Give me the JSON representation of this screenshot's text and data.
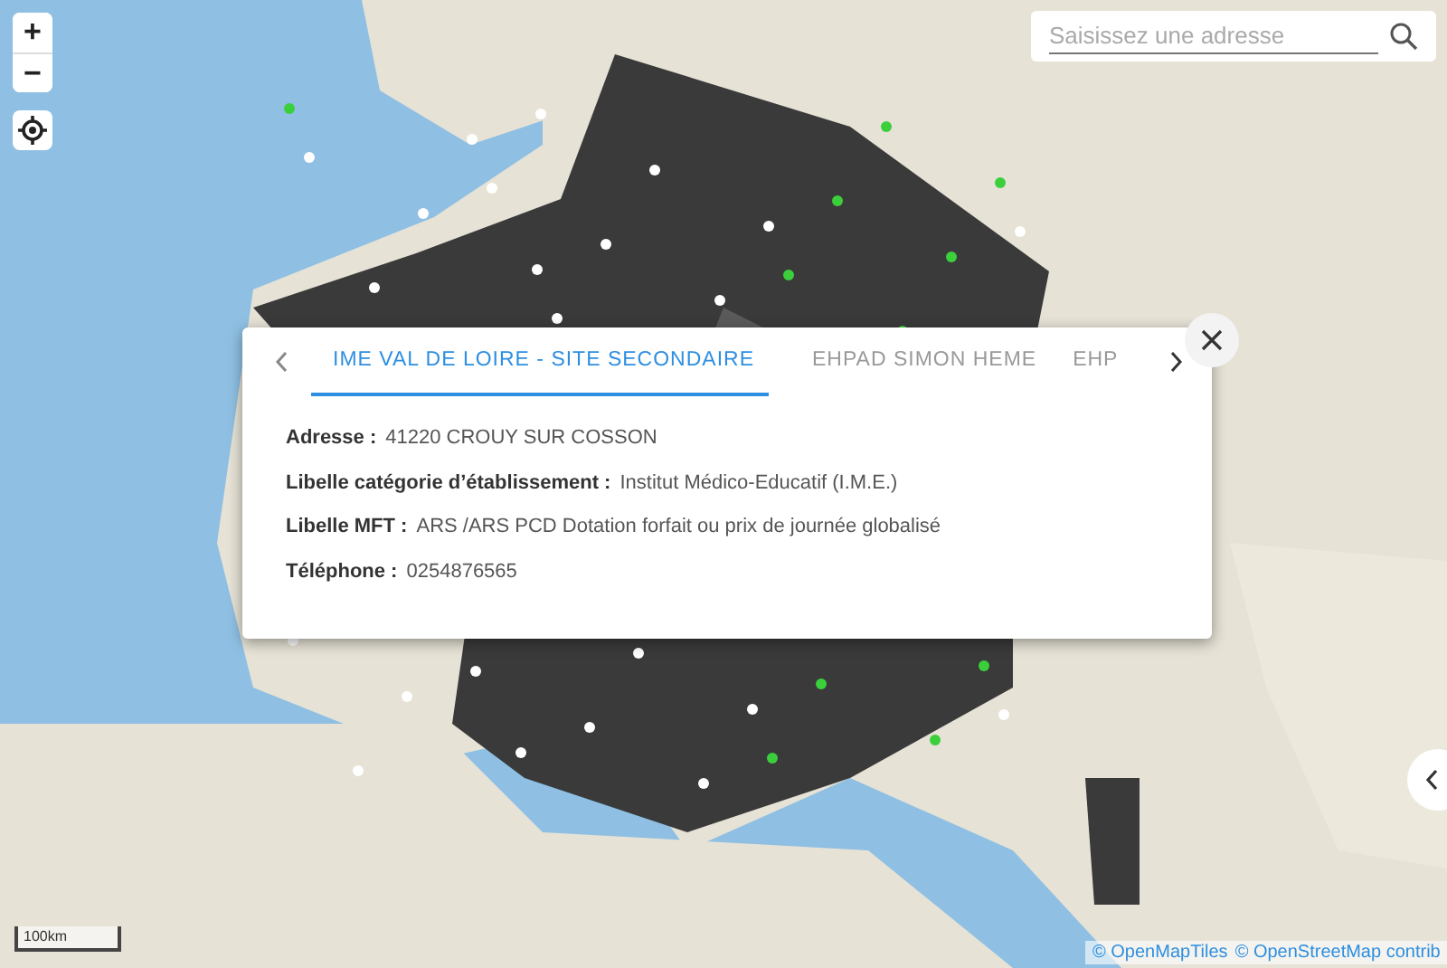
{
  "zoom_controls": {
    "zoom_in": "+",
    "zoom_out": "−"
  },
  "search": {
    "placeholder": "Saisissez une adresse"
  },
  "popup": {
    "tabs": [
      {
        "label": "IME VAL DE LOIRE - SITE SECONDAIRE",
        "selected": true
      },
      {
        "label": "EHPAD SIMON HEME",
        "selected": false
      },
      {
        "label": "EHP",
        "selected": false
      }
    ],
    "fields": [
      {
        "label": "Adresse :",
        "value": "41220 CROUY SUR COSSON"
      },
      {
        "label": "Libelle catégorie d’établissement :",
        "value": "Institut Médico-Educatif (I.M.E.)"
      },
      {
        "label": "Libelle MFT :",
        "value": "ARS /ARS PCD Dotation forfait ou prix de journée globalisé"
      },
      {
        "label": "Téléphone :",
        "value": "0254876565"
      }
    ]
  },
  "scale": "100km",
  "attribution": [
    "© OpenMapTiles",
    "© OpenStreetMap contrib"
  ]
}
